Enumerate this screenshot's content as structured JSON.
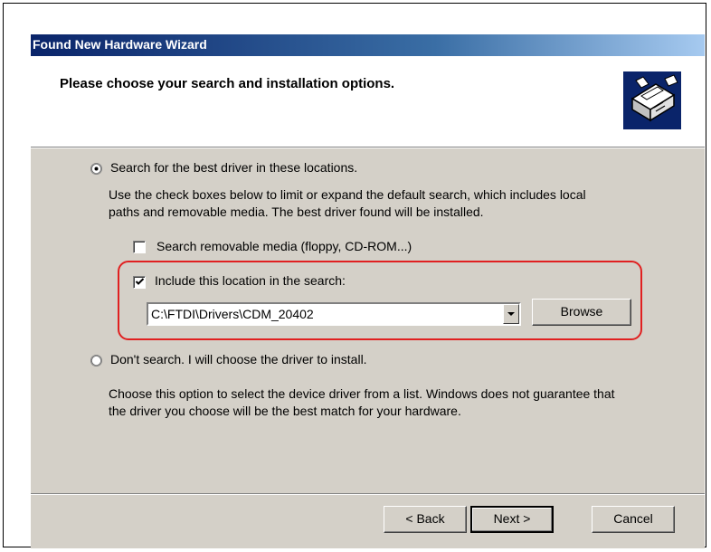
{
  "window": {
    "title": "Found New Hardware Wizard"
  },
  "header": {
    "title": "Please choose your search and installation options.",
    "icon": "hardware-wizard-icon"
  },
  "options": {
    "search": {
      "label": "Search for the best driver in these locations.",
      "selected": true,
      "description_line1": "Use the check boxes below to limit or expand the default search, which includes local",
      "description_line2": "paths and removable media. The best driver found will be installed.",
      "removable_media": {
        "label": "Search removable media (floppy, CD-ROM...)",
        "checked": false
      },
      "include_location": {
        "label": "Include this location in the search:",
        "checked": true,
        "path": "C:\\FTDI\\Drivers\\CDM_20402"
      },
      "browse_label": "Browse"
    },
    "dont_search": {
      "label": "Don't search. I will choose the driver to install.",
      "selected": false,
      "description_line1": "Choose this option to select the device driver from a list.  Windows does not guarantee that",
      "description_line2": "the driver you choose will be the best match for your hardware."
    }
  },
  "footer": {
    "back_label": "< Back",
    "next_label": "Next >",
    "cancel_label": "Cancel"
  },
  "colors": {
    "dialog_bg": "#d4d0c8",
    "title_bar": "#0a246a",
    "highlight": "#e02020"
  }
}
